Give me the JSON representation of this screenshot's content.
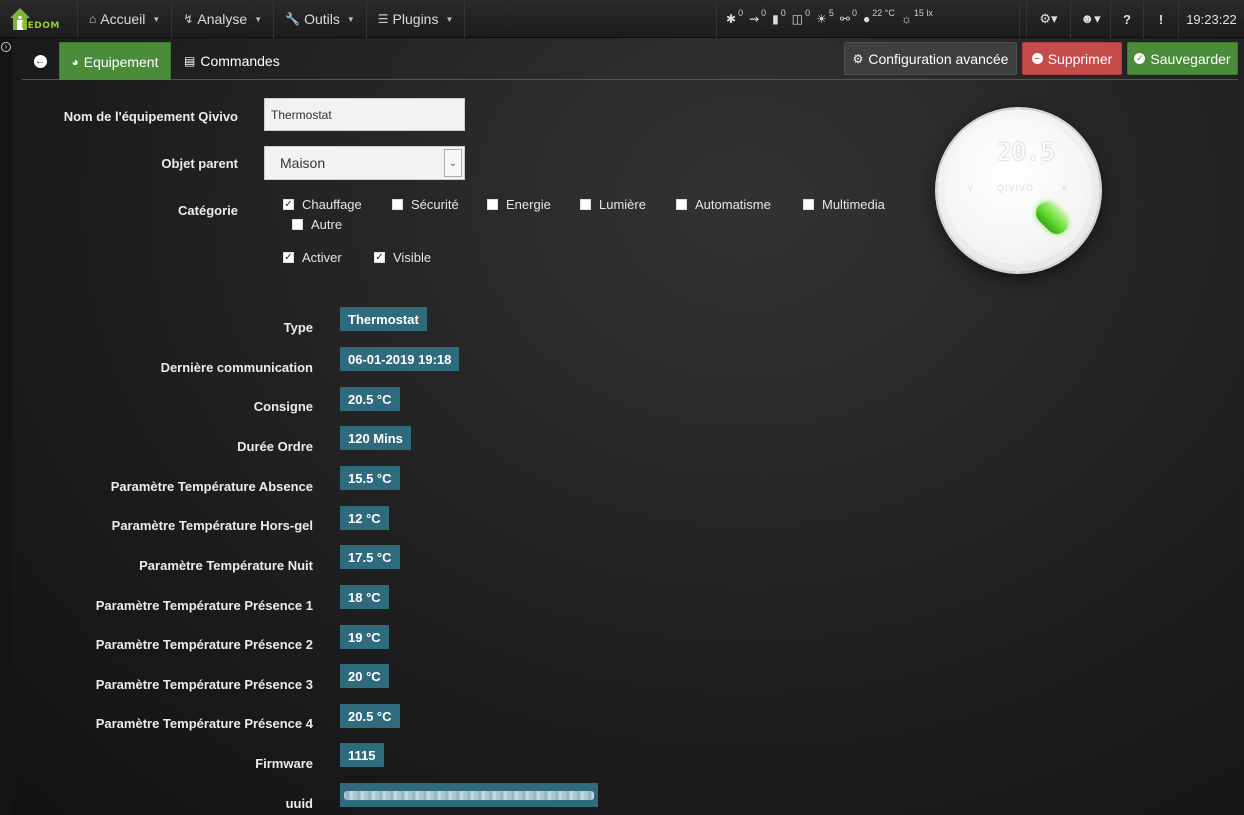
{
  "nav": {
    "logo_text": "EEDOM",
    "items": [
      {
        "label": "Accueil",
        "icon": "home-icon"
      },
      {
        "label": "Analyse",
        "icon": "stethoscope-icon"
      },
      {
        "label": "Outils",
        "icon": "wrench-icon"
      },
      {
        "label": "Plugins",
        "icon": "list-icon"
      }
    ],
    "summary": [
      {
        "icon": "light-icon",
        "value": "0"
      },
      {
        "icon": "motion-icon",
        "value": "0"
      },
      {
        "icon": "door-icon",
        "value": "0"
      },
      {
        "icon": "window-icon",
        "value": "0"
      },
      {
        "icon": "bulb-icon",
        "value": "5"
      },
      {
        "icon": "plug-icon",
        "value": "0"
      },
      {
        "icon": "thermometer-icon",
        "value": "22 °C"
      },
      {
        "icon": "sun-icon",
        "value": "15 lx"
      }
    ],
    "clock": "19:23:22"
  },
  "tabs": {
    "equipement": "Equipement",
    "commandes": "Commandes"
  },
  "actions": {
    "config": "Configuration avancée",
    "delete": "Supprimer",
    "save": "Sauvegarder"
  },
  "form": {
    "name_label": "Nom de l'équipement Qivivo",
    "name_value": "Thermostat",
    "parent_label": "Objet parent",
    "parent_value": "Maison",
    "category_label": "Catégorie",
    "categories": [
      {
        "label": "Chauffage",
        "checked": true
      },
      {
        "label": "Sécurité",
        "checked": false
      },
      {
        "label": "Energie",
        "checked": false
      },
      {
        "label": "Lumière",
        "checked": false
      },
      {
        "label": "Automatisme",
        "checked": false
      },
      {
        "label": "Multimedia",
        "checked": false
      },
      {
        "label": "Autre",
        "checked": false
      }
    ],
    "activer": {
      "label": "Activer",
      "checked": true
    },
    "visible": {
      "label": "Visible",
      "checked": true
    }
  },
  "device": {
    "display_temp": "20.5",
    "brand": "QIVIVO"
  },
  "info": [
    {
      "label": "Type",
      "value": "Thermostat"
    },
    {
      "label": "Dernière communication",
      "value": "06-01-2019 19:18"
    },
    {
      "label": "Consigne",
      "value": "20.5 °C"
    },
    {
      "label": "Durée Ordre",
      "value": "120 Mins"
    },
    {
      "label": "Paramètre Température Absence",
      "value": "15.5 °C"
    },
    {
      "label": "Paramètre Température Hors-gel",
      "value": "12 °C"
    },
    {
      "label": "Paramètre Température Nuit",
      "value": "17.5 °C"
    },
    {
      "label": "Paramètre Température Présence 1",
      "value": "18 °C"
    },
    {
      "label": "Paramètre Température Présence 2",
      "value": "19 °C"
    },
    {
      "label": "Paramètre Température Présence 3",
      "value": "20 °C"
    },
    {
      "label": "Paramètre Température Présence 4",
      "value": "20.5 °C"
    },
    {
      "label": "Firmware",
      "value": "1115"
    },
    {
      "label": "uuid",
      "value": ""
    }
  ]
}
